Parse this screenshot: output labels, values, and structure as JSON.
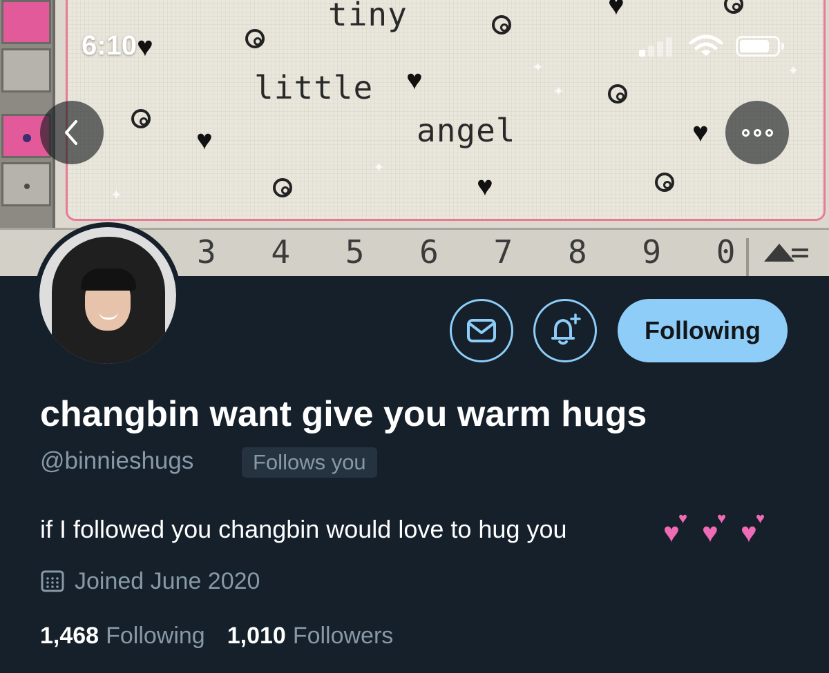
{
  "status_bar": {
    "time": "6:10"
  },
  "header_image": {
    "words": [
      "tiny",
      "little",
      "angel"
    ],
    "key_digits": "3 4 5 6 7 8 9 0 ="
  },
  "nav": {
    "back_icon": "chevron-left-icon",
    "more_icon": "more-dots-icon"
  },
  "profile": {
    "display_name": "changbin want give you warm hugs",
    "handle": "@binnieshugs",
    "follows_you_badge": "Follows you",
    "bio": "if I followed you changbin would love to hug you",
    "joined": "Joined June 2020",
    "stats": {
      "following_count": "1,468",
      "following_label": "Following",
      "followers_count": "1,010",
      "followers_label": "Followers"
    }
  },
  "actions": {
    "message_icon": "envelope-icon",
    "notify_icon": "bell-plus-icon",
    "follow_button_label": "Following"
  },
  "colors": {
    "background": "#15202b",
    "accent": "#8ecdf8",
    "secondary_text": "#8899a6",
    "badge_bg": "#253341"
  }
}
